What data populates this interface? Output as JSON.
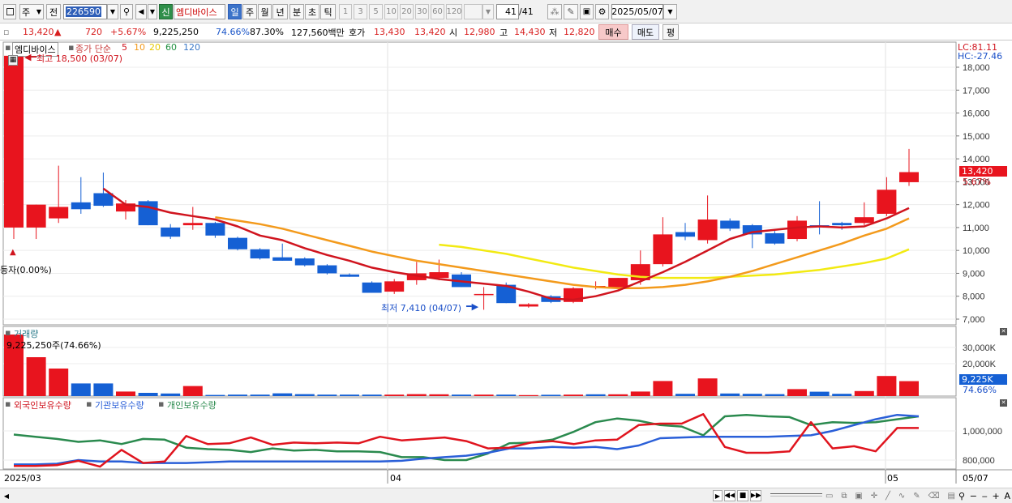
{
  "toolbar": {
    "type_select": "주",
    "prev_label": "전",
    "code": "226590",
    "signal_btn": "신",
    "stock_name": "엠디바이스",
    "periods": [
      "일",
      "주",
      "월",
      "년",
      "분",
      "초",
      "틱"
    ],
    "active_period": "일",
    "intervals": [
      "1",
      "3",
      "5",
      "10",
      "20",
      "30",
      "60",
      "120"
    ],
    "count": "41",
    "count_total": "/41",
    "date": "2025/05/07"
  },
  "quote": {
    "price": "13,420",
    "arrow": "▲",
    "change": "720",
    "change_pct": "+5.67%",
    "volume": "9,225,250",
    "vol_ratio": "74.66%",
    "turnover": "87.30%",
    "amount": "127,560백만",
    "ask_label": "호가",
    "ask": "13,430",
    "bid": "13,420",
    "open_label": "시",
    "open": "12,980",
    "high_label": "고",
    "high": "14,430",
    "low_label": "저",
    "low": "12,820",
    "buy_label": "매수",
    "sell_label": "매도",
    "eval_label": "평"
  },
  "colors": {
    "up": "#e8141e",
    "down": "#1560d4",
    "ma5": "#d0141e",
    "ma10": "#f39a1c",
    "ma20": "#f2ea12",
    "ma60": "#1f8f3f",
    "ma120": "#3a78c8",
    "foreign": "#e0141e",
    "inst": "#2a5fd8",
    "indiv": "#2a8a4e"
  },
  "price_panel": {
    "legend_name": "엠디바이스",
    "legend_ma_label": "종가 단순",
    "ma_periods": [
      "5",
      "10",
      "20",
      "60",
      "120"
    ],
    "high_annotation": "최고 18,500 (03/07)",
    "low_annotation": "최저 7,410 (04/07)",
    "listing_note": "등자(0.00%)",
    "lc": "LC:81.11",
    "hc": "HC:-27.46",
    "current_tag": "13,420",
    "current_pct": "5.67%"
  },
  "volume_panel": {
    "title": "거래량",
    "info": "9,225,250주(74.66%)",
    "current_tag": "9,225K",
    "current_pct": "74.66%"
  },
  "holding_panel": {
    "series_names": [
      "외국인보유수량",
      "기관보유수량",
      "개인보유수량"
    ]
  },
  "x_axis": {
    "labels": [
      "2025/03",
      "04",
      "05",
      "05/07"
    ]
  },
  "chart_data": [
    {
      "type": "candlestick",
      "title": "엠디바이스",
      "y_ticks": [
        7000,
        8000,
        9000,
        10000,
        11000,
        12000,
        13000,
        14000,
        15000,
        16000,
        17000,
        18000
      ],
      "ylim": [
        6700,
        18800
      ],
      "candles": [
        {
          "o": 11000,
          "h": 18500,
          "l": 10500,
          "c": 18500
        },
        {
          "o": 11000,
          "h": 12000,
          "l": 10500,
          "c": 12000
        },
        {
          "o": 11400,
          "h": 13700,
          "l": 11200,
          "c": 11900
        },
        {
          "o": 12100,
          "h": 13200,
          "l": 11600,
          "c": 11800
        },
        {
          "o": 12500,
          "h": 13400,
          "l": 11900,
          "c": 11950
        },
        {
          "o": 11700,
          "h": 12200,
          "l": 11350,
          "c": 12050
        },
        {
          "o": 12150,
          "h": 12200,
          "l": 11100,
          "c": 11100
        },
        {
          "o": 11000,
          "h": 11150,
          "l": 10500,
          "c": 10600
        },
        {
          "o": 11100,
          "h": 11900,
          "l": 10900,
          "c": 11200
        },
        {
          "o": 11200,
          "h": 11250,
          "l": 10550,
          "c": 10650
        },
        {
          "o": 10550,
          "h": 10600,
          "l": 10000,
          "c": 10050
        },
        {
          "o": 10050,
          "h": 10100,
          "l": 9600,
          "c": 9650
        },
        {
          "o": 9700,
          "h": 10300,
          "l": 9550,
          "c": 9550
        },
        {
          "o": 9650,
          "h": 9700,
          "l": 9300,
          "c": 9350
        },
        {
          "o": 9350,
          "h": 9400,
          "l": 8950,
          "c": 9000
        },
        {
          "o": 8950,
          "h": 9000,
          "l": 8850,
          "c": 8850
        },
        {
          "o": 8600,
          "h": 8650,
          "l": 8150,
          "c": 8150
        },
        {
          "o": 8200,
          "h": 8750,
          "l": 8100,
          "c": 8650
        },
        {
          "o": 8700,
          "h": 9500,
          "l": 8500,
          "c": 9000
        },
        {
          "o": 8800,
          "h": 9600,
          "l": 8700,
          "c": 9050
        },
        {
          "o": 8950,
          "h": 9050,
          "l": 8400,
          "c": 8400
        },
        {
          "o": 8100,
          "h": 8400,
          "l": 7410,
          "c": 8100
        },
        {
          "o": 8500,
          "h": 8600,
          "l": 7700,
          "c": 7700
        },
        {
          "o": 7550,
          "h": 7700,
          "l": 7500,
          "c": 7650
        },
        {
          "o": 8000,
          "h": 8050,
          "l": 7700,
          "c": 7750
        },
        {
          "o": 7750,
          "h": 8400,
          "l": 7700,
          "c": 8350
        },
        {
          "o": 8450,
          "h": 8650,
          "l": 8300,
          "c": 8450
        },
        {
          "o": 8350,
          "h": 8800,
          "l": 8300,
          "c": 8800
        },
        {
          "o": 8700,
          "h": 10000,
          "l": 8500,
          "c": 9400
        },
        {
          "o": 9400,
          "h": 11450,
          "l": 9300,
          "c": 10700
        },
        {
          "o": 10800,
          "h": 11200,
          "l": 10450,
          "c": 10600
        },
        {
          "o": 10450,
          "h": 12400,
          "l": 10300,
          "c": 11350
        },
        {
          "o": 11300,
          "h": 11400,
          "l": 10850,
          "c": 10950
        },
        {
          "o": 11100,
          "h": 11150,
          "l": 10100,
          "c": 10700
        },
        {
          "o": 10750,
          "h": 10850,
          "l": 10250,
          "c": 10300
        },
        {
          "o": 10500,
          "h": 11500,
          "l": 10400,
          "c": 11300
        },
        {
          "o": 11100,
          "h": 12150,
          "l": 10700,
          "c": 11050
        },
        {
          "o": 11200,
          "h": 11250,
          "l": 10900,
          "c": 11100
        },
        {
          "o": 11200,
          "h": 12100,
          "l": 11100,
          "c": 11450
        },
        {
          "o": 11600,
          "h": 13200,
          "l": 11500,
          "c": 12650
        },
        {
          "o": 12980,
          "h": 14430,
          "l": 12820,
          "c": 13420
        }
      ],
      "ma5": [
        null,
        null,
        null,
        null,
        12700,
        12000,
        11900,
        11650,
        11500,
        11350,
        11050,
        10650,
        10450,
        10100,
        9800,
        9550,
        9250,
        9050,
        8900,
        8750,
        8650,
        8550,
        8450,
        8200,
        7900,
        7850,
        8000,
        8250,
        8650,
        9050,
        9500,
        10000,
        10500,
        10800,
        10900,
        11000,
        11050,
        11000,
        11050,
        11400,
        11850
      ],
      "ma10": [
        null,
        null,
        null,
        null,
        null,
        null,
        null,
        null,
        null,
        11450,
        11300,
        11150,
        10950,
        10700,
        10450,
        10200,
        9950,
        9750,
        9550,
        9400,
        9250,
        9100,
        8950,
        8800,
        8650,
        8500,
        8400,
        8350,
        8350,
        8400,
        8500,
        8650,
        8850,
        9100,
        9400,
        9700,
        10000,
        10300,
        10650,
        10950,
        11400
      ],
      "ma20": [
        null,
        null,
        null,
        null,
        null,
        null,
        null,
        null,
        null,
        null,
        null,
        null,
        null,
        null,
        null,
        null,
        null,
        null,
        null,
        10250,
        10150,
        10000,
        9850,
        9650,
        9450,
        9250,
        9100,
        8950,
        8850,
        8800,
        8800,
        8800,
        8850,
        8900,
        8950,
        9050,
        9150,
        9300,
        9450,
        9650,
        10050
      ]
    },
    {
      "type": "bar",
      "title": "거래량",
      "y_ticks": [
        20000,
        30000
      ],
      "ylim": [
        0,
        40000
      ],
      "unit": "K",
      "values": [
        38000,
        24000,
        17000,
        7800,
        7800,
        2800,
        2000,
        1600,
        6200,
        700,
        900,
        900,
        1700,
        1200,
        900,
        900,
        900,
        900,
        1200,
        1100,
        900,
        900,
        900,
        600,
        800,
        900,
        1100,
        1100,
        2800,
        9300,
        1400,
        10900,
        1600,
        1400,
        1200,
        4300,
        2700,
        1400,
        3100,
        12400,
        9225
      ],
      "up": [
        true,
        true,
        true,
        false,
        false,
        true,
        false,
        false,
        true,
        false,
        false,
        false,
        false,
        false,
        false,
        false,
        false,
        true,
        true,
        true,
        false,
        true,
        false,
        true,
        false,
        true,
        false,
        true,
        true,
        true,
        false,
        true,
        false,
        false,
        false,
        true,
        false,
        false,
        true,
        true,
        true
      ]
    },
    {
      "type": "line",
      "ylim": [
        720000,
        1160000
      ],
      "y_ticks": [
        800000,
        1000000
      ],
      "series": [
        {
          "name": "외국인보유수량",
          "values": [
            760000,
            760000,
            765000,
            795000,
            755000,
            870000,
            780000,
            790000,
            965000,
            910000,
            915000,
            955000,
            905000,
            920000,
            915000,
            920000,
            915000,
            960000,
            935000,
            945000,
            955000,
            930000,
            880000,
            885000,
            920000,
            930000,
            910000,
            935000,
            940000,
            1040000,
            1050000,
            1050000,
            1115000,
            890000,
            850000,
            850000,
            860000,
            1060000,
            880000,
            895000,
            860000,
            1020000,
            1020000
          ]
        },
        {
          "name": "기관보유수량",
          "values": [
            770000,
            770000,
            775000,
            800000,
            790000,
            790000,
            780000,
            780000,
            780000,
            785000,
            790000,
            790000,
            790000,
            790000,
            790000,
            790000,
            790000,
            790000,
            795000,
            810000,
            820000,
            830000,
            850000,
            880000,
            880000,
            890000,
            885000,
            890000,
            875000,
            900000,
            950000,
            955000,
            960000,
            960000,
            960000,
            960000,
            965000,
            970000,
            1000000,
            1040000,
            1080000,
            1110000,
            1100000
          ]
        },
        {
          "name": "개인보유수량",
          "values": [
            975000,
            960000,
            945000,
            925000,
            935000,
            910000,
            945000,
            940000,
            885000,
            875000,
            870000,
            855000,
            880000,
            865000,
            870000,
            860000,
            860000,
            855000,
            820000,
            820000,
            800000,
            800000,
            845000,
            915000,
            920000,
            940000,
            995000,
            1060000,
            1085000,
            1070000,
            1040000,
            1030000,
            970000,
            1100000,
            1110000,
            1100000,
            1095000,
            1040000,
            1060000,
            1055000,
            1060000,
            1080000,
            1100000
          ]
        }
      ]
    }
  ]
}
